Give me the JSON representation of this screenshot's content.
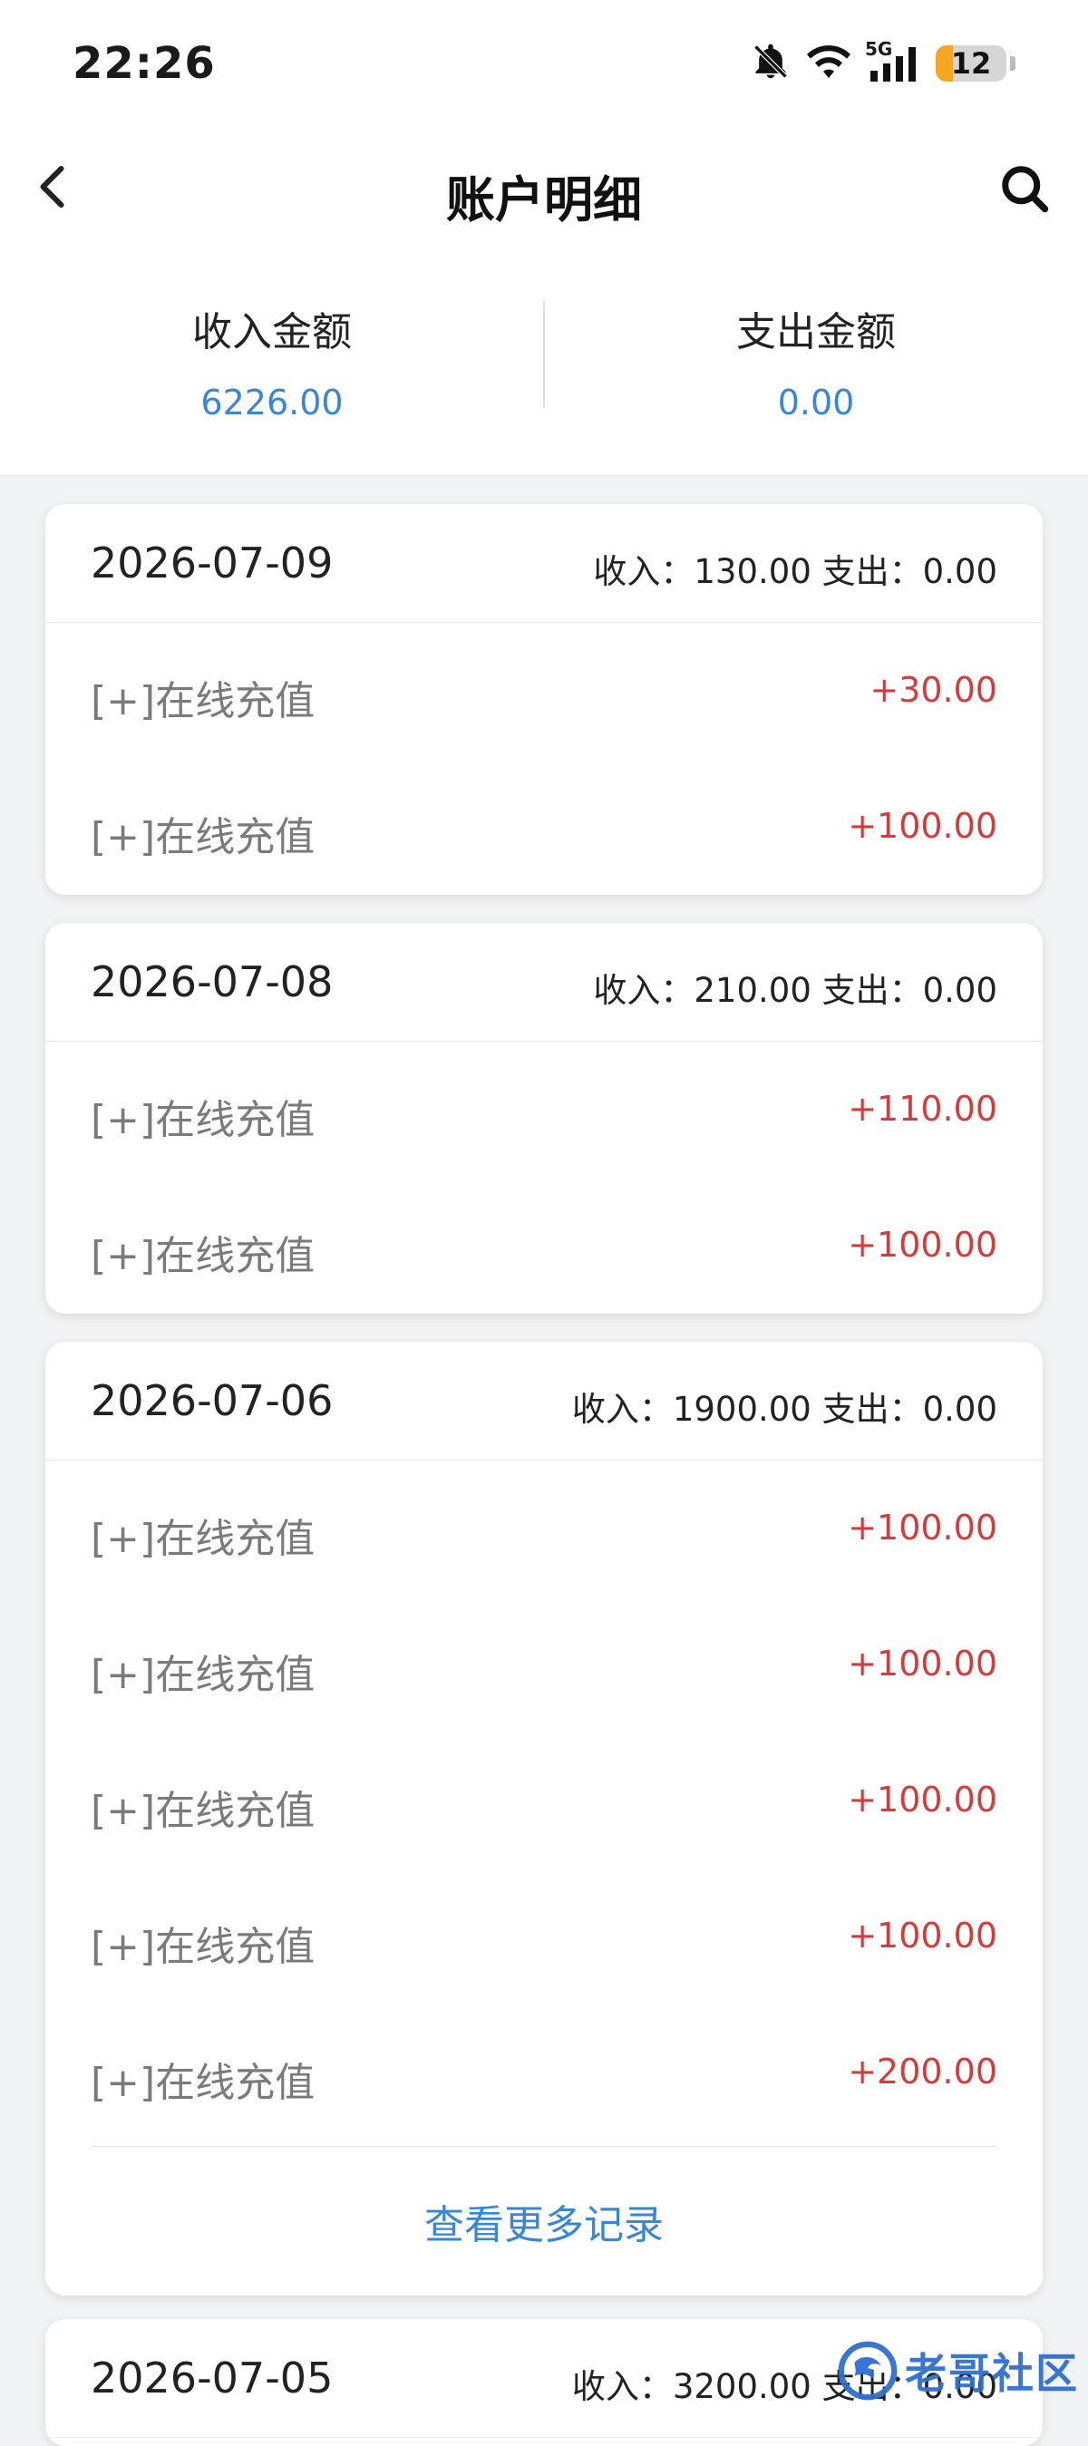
{
  "status_bar": {
    "time": "22:26",
    "network": "5G",
    "battery": "12"
  },
  "header": {
    "title": "账户明细"
  },
  "summary": {
    "income_label": "收入金额",
    "income_value": "6226.00",
    "expense_label": "支出金额",
    "expense_value": "0.00"
  },
  "days": [
    {
      "date": "2026-07-09",
      "stats": "收入：130.00 支出：0.00",
      "items": [
        {
          "label": "[+]在线充值",
          "amount": "+30.00"
        },
        {
          "label": "[+]在线充值",
          "amount": "+100.00"
        }
      ]
    },
    {
      "date": "2026-07-08",
      "stats": "收入：210.00 支出：0.00",
      "items": [
        {
          "label": "[+]在线充值",
          "amount": "+110.00"
        },
        {
          "label": "[+]在线充值",
          "amount": "+100.00"
        }
      ]
    },
    {
      "date": "2026-07-06",
      "stats": "收入：1900.00 支出：0.00",
      "items": [
        {
          "label": "[+]在线充值",
          "amount": "+100.00"
        },
        {
          "label": "[+]在线充值",
          "amount": "+100.00"
        },
        {
          "label": "[+]在线充值",
          "amount": "+100.00"
        },
        {
          "label": "[+]在线充值",
          "amount": "+100.00"
        },
        {
          "label": "[+]在线充值",
          "amount": "+200.00"
        }
      ],
      "more_label": "查看更多记录"
    },
    {
      "date": "2026-07-05",
      "stats": "收入：3200.00 支出：0.00",
      "items": []
    }
  ],
  "watermark": {
    "text": "老哥社区"
  },
  "colors": {
    "accent": "#3a86d6",
    "amount_red": "#d43b3b",
    "background": "#f2f3f5"
  }
}
